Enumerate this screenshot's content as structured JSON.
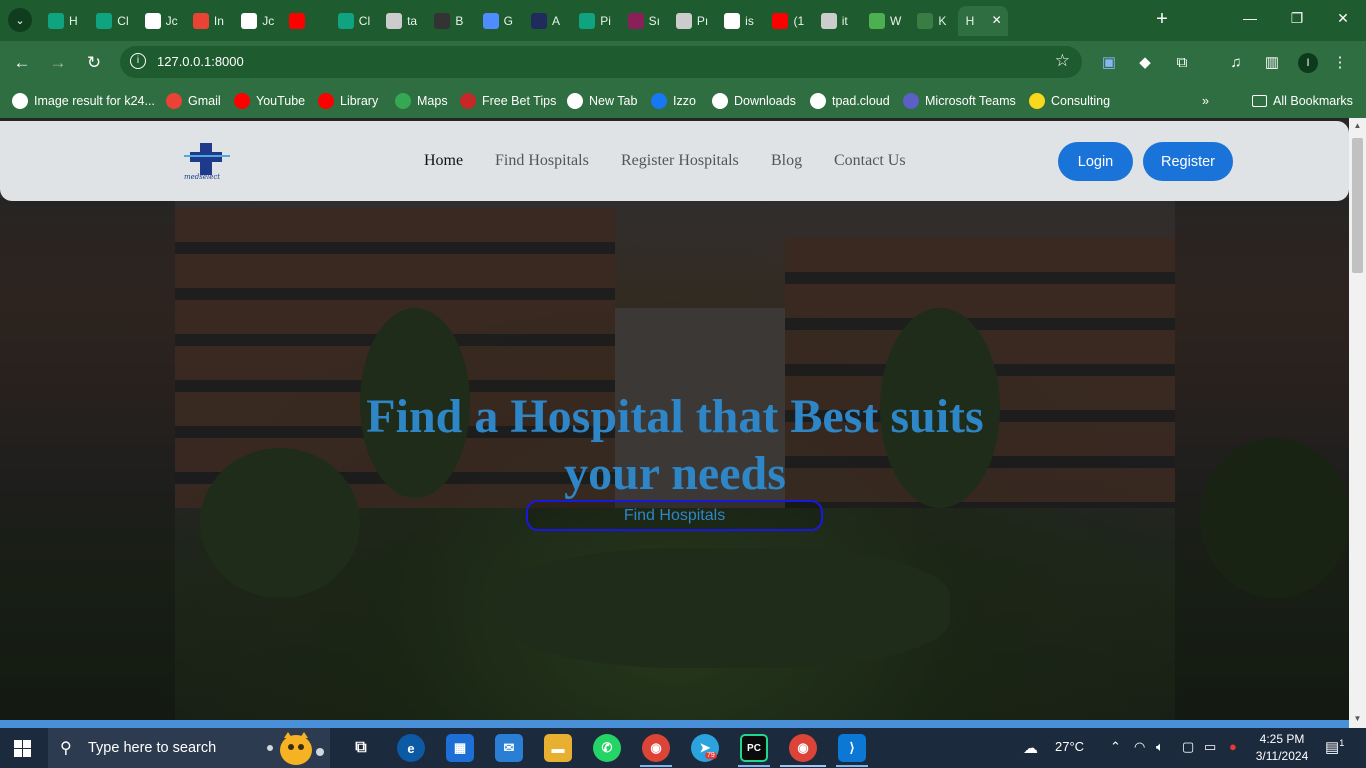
{
  "browser": {
    "tabs": [
      {
        "label": "H",
        "icon": "chatgpt-icon",
        "color": "#10a37f"
      },
      {
        "label": "Cl",
        "icon": "chatgpt-icon",
        "color": "#10a37f"
      },
      {
        "label": "Jc",
        "icon": "doc-icon",
        "color": "#ffffff"
      },
      {
        "label": "In",
        "icon": "gmail-icon",
        "color": "#ea4335"
      },
      {
        "label": "Jc",
        "icon": "doc-icon",
        "color": "#ffffff"
      },
      {
        "label": "",
        "icon": "youtube-audio-icon",
        "color": "#ff0000"
      },
      {
        "label": "Cl",
        "icon": "chatgpt-icon",
        "color": "#10a37f"
      },
      {
        "label": "ta",
        "icon": "globe-icon",
        "color": "#cccccc"
      },
      {
        "label": "B",
        "icon": "bing-icon",
        "color": "#333333"
      },
      {
        "label": "G",
        "icon": "gemini-icon",
        "color": "#4e8cff"
      },
      {
        "label": "A",
        "icon": "app-icon",
        "color": "#1f2b5c"
      },
      {
        "label": "Pi",
        "icon": "chatgpt-icon",
        "color": "#10a37f"
      },
      {
        "label": "Sı",
        "icon": "stats-icon",
        "color": "#8b1f5a"
      },
      {
        "label": "Pı",
        "icon": "globe-icon",
        "color": "#cccccc"
      },
      {
        "label": "is",
        "icon": "github-icon",
        "color": "#ffffff"
      },
      {
        "label": "(1",
        "icon": "youtube-icon",
        "color": "#ff0000"
      },
      {
        "label": "it",
        "icon": "globe-icon",
        "color": "#cccccc"
      },
      {
        "label": "W",
        "icon": "app-icon",
        "color": "#4caf50"
      },
      {
        "label": "K",
        "icon": "app-icon",
        "color": "#3a7d44"
      },
      {
        "label": "H",
        "icon": "",
        "color": "",
        "active": true
      }
    ],
    "url": "127.0.0.1:8000",
    "profile_initial": "I",
    "bookmarks": [
      {
        "label": "Image result for k24...",
        "icon": "google-icon",
        "color": "#ffffff"
      },
      {
        "label": "Gmail",
        "icon": "gmail-icon",
        "color": "#ea4335"
      },
      {
        "label": "YouTube",
        "icon": "youtube-icon",
        "color": "#ff0000"
      },
      {
        "label": "Library",
        "icon": "youtube-icon",
        "color": "#ff0000"
      },
      {
        "label": "Maps",
        "icon": "maps-icon",
        "color": "#34a853"
      },
      {
        "label": "Free Bet Tips",
        "icon": "app-icon",
        "color": "#c62828"
      },
      {
        "label": "New Tab",
        "icon": "globe-icon",
        "color": "#ffffff"
      },
      {
        "label": "Izzo",
        "icon": "facebook-icon",
        "color": "#1877f2"
      },
      {
        "label": "Downloads",
        "icon": "download-icon",
        "color": "#ffffff"
      },
      {
        "label": "tpad.cloud",
        "icon": "globe-icon",
        "color": "#ffffff"
      },
      {
        "label": "Microsoft Teams",
        "icon": "teams-icon",
        "color": "#5b5fc7"
      },
      {
        "label": "Consulting",
        "icon": "app-icon",
        "color": "#f9d71c"
      }
    ],
    "all_bookmarks": "All Bookmarks"
  },
  "site": {
    "logo_text": "medselect",
    "nav": [
      "Home",
      "Find Hospitals",
      "Register Hospitals",
      "Blog",
      "Contact Us"
    ],
    "login": "Login",
    "register": "Register",
    "hero_title": "Find a Hospital that Best suits your needs",
    "hero_button": "Find Hospitals",
    "accent": "#1a73d9",
    "title_color": "#2e86c7"
  },
  "taskbar": {
    "search_placeholder": "Type here to search",
    "weather": "27°C",
    "time": "4:25 PM",
    "date": "3/11/2024",
    "telegram_badge": "79",
    "notification_count": "1"
  }
}
